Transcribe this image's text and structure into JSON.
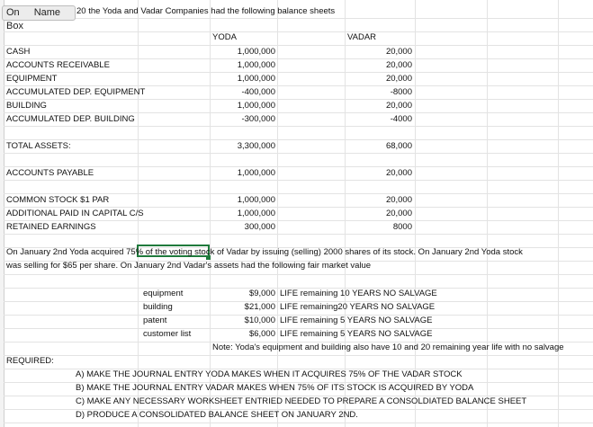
{
  "name_box": {
    "prefix": "On",
    "label": "Name Box",
    "suffix": "20 the Yoda and Vadar Companies had the following balance sheets"
  },
  "columns": {
    "yoda": "YODA",
    "vadar": "VADAR"
  },
  "balance_sheet": [
    {
      "label": "CASH",
      "yoda": "1,000,000",
      "vadar": "20,000"
    },
    {
      "label": "ACCOUNTS RECEIVABLE",
      "yoda": "1,000,000",
      "vadar": "20,000"
    },
    {
      "label": "EQUIPMENT",
      "yoda": "1,000,000",
      "vadar": "20,000"
    },
    {
      "label": "ACCUMULATED DEP. EQUIPMENT",
      "yoda": "-400,000",
      "vadar": "-8000"
    },
    {
      "label": "BUILDING",
      "yoda": "1,000,000",
      "vadar": "20,000"
    },
    {
      "label": "ACCUMULATED DEP. BUILDING",
      "yoda": "-300,000",
      "vadar": "-4000"
    },
    {
      "label": "TOTAL ASSETS:",
      "yoda": "3,300,000",
      "vadar": "68,000"
    },
    {
      "label": "ACCOUNTS PAYABLE",
      "yoda": "1,000,000",
      "vadar": "20,000"
    },
    {
      "label": "COMMON STOCK $1 PAR",
      "yoda": "1,000,000",
      "vadar": "20,000"
    },
    {
      "label": "ADDITIONAL PAID IN CAPITAL C/S",
      "yoda": "1,000,000",
      "vadar": "20,000"
    },
    {
      "label": "RETAINED EARNINGS",
      "yoda": "300,000",
      "vadar": "8000"
    }
  ],
  "narrative": [
    "On January 2nd Yoda acquired 75% of the voting stock of Vadar by issuing (selling) 2000 shares of its stock.  On January 2nd Yoda stock",
    "was selling for $65 per share.  On January 2nd Vadar's assets had the following fair market value"
  ],
  "fair_values": [
    {
      "asset": "equipment",
      "value": "$9,000",
      "life": "LIFE remaining 10 YEARS NO SALVAGE"
    },
    {
      "asset": "building",
      "value": "$21,000",
      "life": "LIFE remaining20 YEARS NO SALVAGE"
    },
    {
      "asset": "patent",
      "value": "$10,000",
      "life": "LIFE remaining 5 YEARS NO SALVAGE"
    },
    {
      "asset": "customer list",
      "value": "$6,000",
      "life": "LIFE remaining  5 YEARS NO SALVAGE"
    }
  ],
  "note": "Note: Yoda's equipment and building also have 10 and 20 remaining  year life with no salvage",
  "required_label": "REQUIRED:",
  "required": [
    "A) MAKE THE JOURNAL ENTRY YODA MAKES WHEN IT ACQUIRES 75% OF THE VADAR STOCK",
    "B) MAKE THE JOURNAL ENTRY VADAR MAKES WHEN 75% OF  ITS STOCK IS ACQUIRED BY YODA",
    "C) MAKE ANY NECESSARY WORKSHEET ENTRIED NEEDED TO PREPARE A CONSOLDIATED BALANCE SHEET",
    "D) PRODUCE A CONSOLIDATED BALANCE SHEET ON JANUARY 2ND."
  ]
}
